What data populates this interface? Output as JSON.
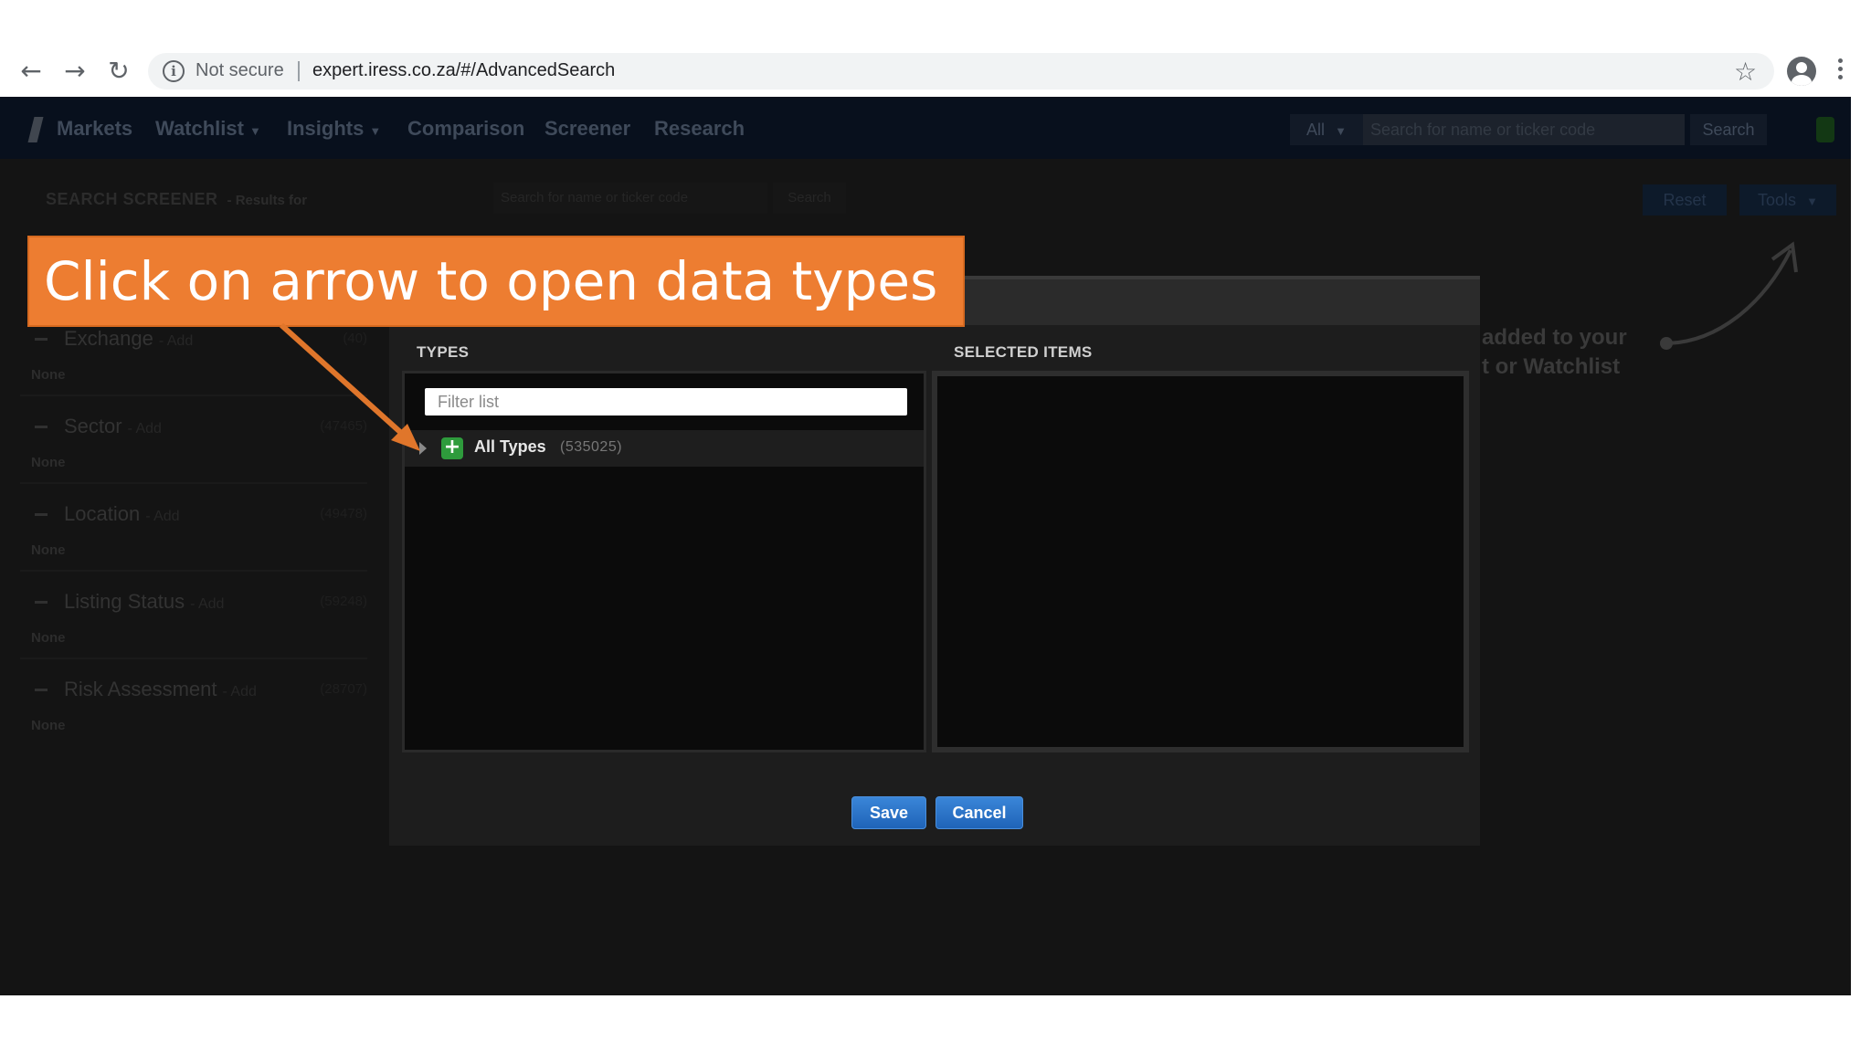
{
  "browser": {
    "security_label": "Not secure",
    "url": "expert.iress.co.za/#/AdvancedSearch"
  },
  "app_nav": {
    "items": [
      "Markets",
      "Watchlist",
      "Insights",
      "Comparison",
      "Screener",
      "Research"
    ],
    "select_label": "All",
    "search_placeholder": "Search for name or ticker code",
    "search_button": "Search"
  },
  "screener": {
    "title": "SEARCH SCREENER",
    "subtitle": "- Results for",
    "search_placeholder": "Search for name or ticker code",
    "search_button": "Search",
    "reset_button": "Reset",
    "tools_button": "Tools"
  },
  "filters": [
    {
      "name": "Exchange",
      "add": "- Add",
      "count": "(40)",
      "value": "None"
    },
    {
      "name": "Sector",
      "add": "- Add",
      "count": "(47465)",
      "value": "None"
    },
    {
      "name": "Location",
      "add": "- Add",
      "count": "(49478)",
      "value": "None"
    },
    {
      "name": "Listing Status",
      "add": "- Add",
      "count": "(59248)",
      "value": "None"
    },
    {
      "name": "Risk Assessment",
      "add": "- Add",
      "count": "(28707)",
      "value": "None"
    }
  ],
  "background_hint": {
    "line1": "added to your",
    "line2": "t or Watchlist"
  },
  "modal": {
    "types_header": "TYPES",
    "selected_header": "SELECTED ITEMS",
    "filter_placeholder": "Filter list",
    "tree_item_label": "All Types",
    "tree_item_count": "(535025)",
    "save_button": "Save",
    "cancel_button": "Cancel"
  },
  "callout": {
    "text": "Click on arrow to open data types",
    "color": "#ed7d31"
  },
  "colors": {
    "nav_bg": "#08101d",
    "modal_bg": "#1d1d1d",
    "button_blue": "#1f64b8",
    "plus_green": "#2e9b3c"
  }
}
